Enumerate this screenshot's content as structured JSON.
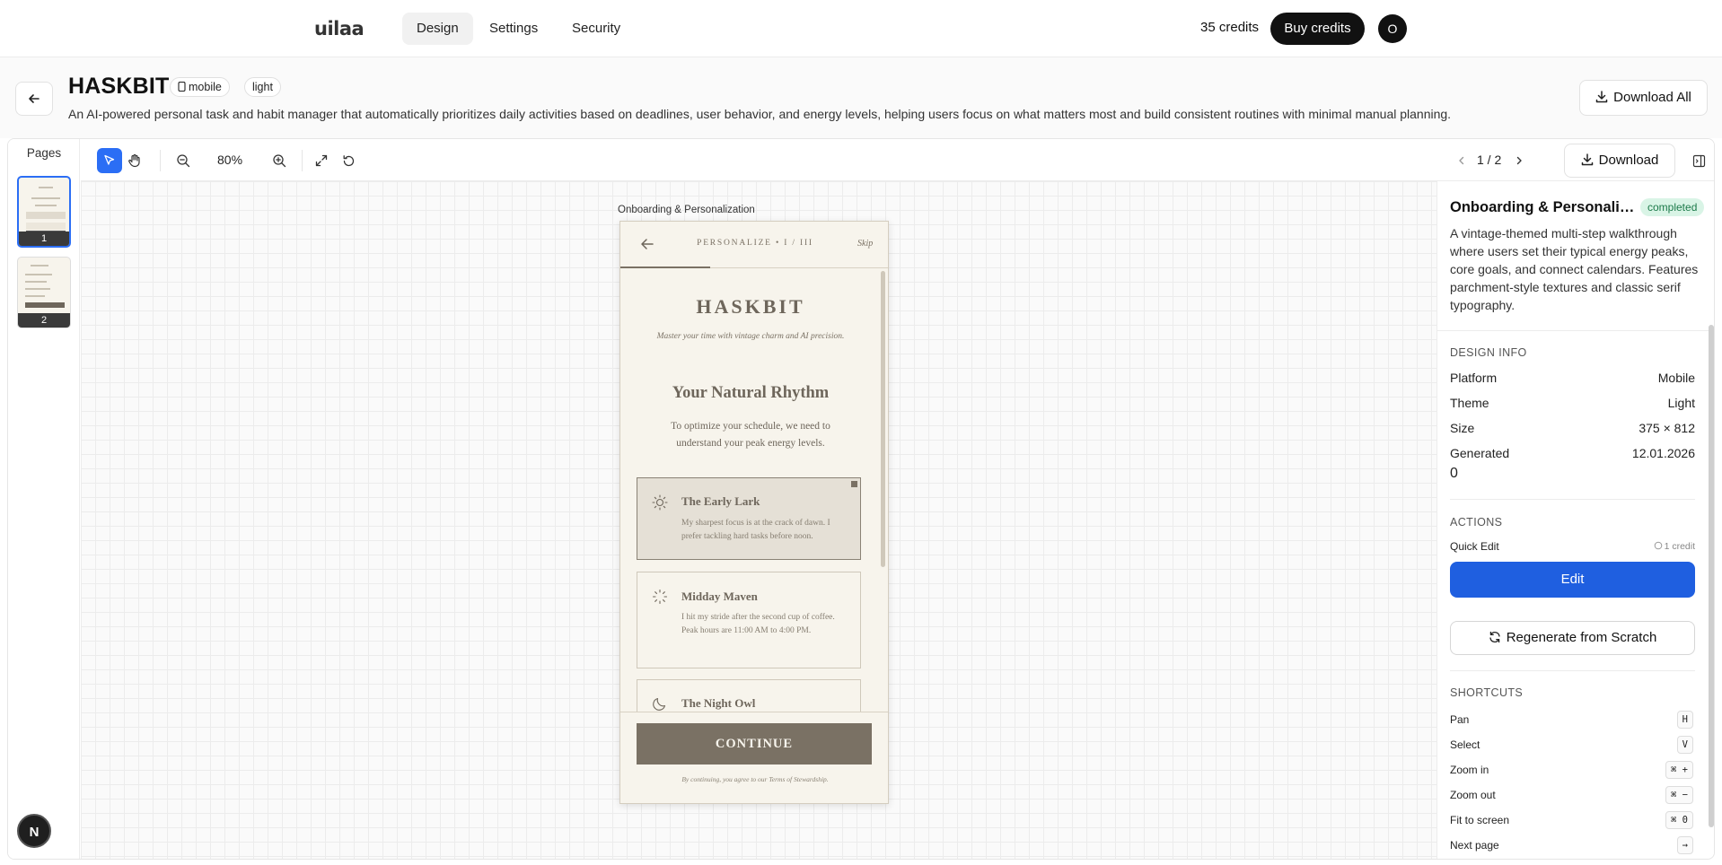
{
  "nav": {
    "logo": "uilaa",
    "tabs": [
      "Design",
      "Settings",
      "Security"
    ],
    "active_tab": "Design",
    "credits": "35 credits",
    "buy_label": "Buy credits",
    "avatar_initial": "O"
  },
  "header": {
    "title": "HASKBIT",
    "platform_badge": "mobile",
    "theme_badge": "light",
    "description": "An AI-powered personal task and habit manager that automatically prioritizes daily activities based on deadlines, user behavior, and energy levels, helping users focus on what matters most and build consistent routines with minimal manual planning.",
    "download_all_label": "Download All"
  },
  "pages_panel": {
    "title": "Pages",
    "pages": [
      "1",
      "2"
    ],
    "active": "1",
    "n_badge": "N"
  },
  "toolbar": {
    "zoom": "80%",
    "pager": "1 / 2",
    "download_label": "Download"
  },
  "canvas": {
    "frame_label": "Onboarding & Personalization"
  },
  "phone": {
    "step": "PERSONALIZE • I / III",
    "skip": "Skip",
    "brand": "HASKBIT",
    "tagline": "Master your time with vintage charm and AI precision.",
    "heading": "Your Natural Rhythm",
    "subheading": "To optimize your schedule, we need to understand your peak energy levels.",
    "options": [
      {
        "title": "The Early Lark",
        "desc": "My sharpest focus is at the crack of dawn. I prefer tackling hard tasks before noon.",
        "icon": "sun-icon",
        "selected": true
      },
      {
        "title": "Midday Maven",
        "desc": "I hit my stride after the second cup of coffee. Peak hours are 11:00 AM to 4:00 PM.",
        "icon": "loading-sun-icon",
        "selected": false
      },
      {
        "title": "The Night Owl",
        "desc": "",
        "icon": "moon-icon",
        "selected": false
      }
    ],
    "cta": "CONTINUE",
    "legal": "By continuing, you agree to our Terms of Stewardship."
  },
  "right_panel": {
    "title": "Onboarding & Personaliza...",
    "status": "completed",
    "description": "A vintage-themed multi-step walkthrough where users set their typical energy peaks, core goals, and connect calendars. Features parchment-style textures and classic serif typography.",
    "design_info_title": "DESIGN INFO",
    "info": [
      {
        "k": "Platform",
        "v": "Mobile"
      },
      {
        "k": "Theme",
        "v": "Light"
      },
      {
        "k": "Size",
        "v": "375 × 812"
      },
      {
        "k": "Generated",
        "v": "12.01.2026"
      }
    ],
    "generated_extra": "0",
    "actions_title": "ACTIONS",
    "quick_edit_label": "Quick Edit",
    "quick_edit_cost": "1 credit",
    "edit_label": "Edit",
    "regen_label": "Regenerate from Scratch",
    "shortcuts_title": "SHORTCUTS",
    "shortcuts": [
      {
        "k": "Pan",
        "key": "H"
      },
      {
        "k": "Select",
        "key": "V"
      },
      {
        "k": "Zoom in",
        "key": "⌘ +"
      },
      {
        "k": "Zoom out",
        "key": "⌘ −"
      },
      {
        "k": "Fit to screen",
        "key": "⌘ 0"
      },
      {
        "k": "Next page",
        "key": "→"
      }
    ]
  },
  "colors": {
    "accent_blue": "#2b6ef5",
    "edit_blue": "#1f5fe0",
    "parchment": "#f7f4ec",
    "ink": "#6e665b",
    "completed_bg": "#d9f4e6",
    "completed_fg": "#1c7a4a"
  }
}
